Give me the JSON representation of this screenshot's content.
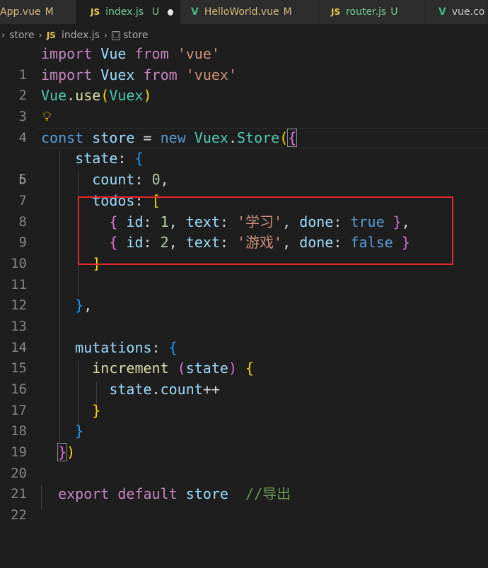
{
  "tabs": [
    {
      "label": "App.vue",
      "status": "M"
    },
    {
      "label": "index.js",
      "status": "U"
    },
    {
      "label": "HelloWorld.vue",
      "status": "M"
    },
    {
      "label": "router.js",
      "status": "U"
    },
    {
      "label": "vue.co"
    }
  ],
  "breadcrumb": {
    "folder": "store",
    "file": "index.js",
    "symbol": "store"
  },
  "line_numbers": [
    "1",
    "2",
    "3",
    "4",
    "5",
    "6",
    "7",
    "8",
    "9",
    "10",
    "11",
    "12",
    "13",
    "14",
    "15",
    "16",
    "17",
    "18",
    "19",
    "20",
    "21",
    "22"
  ],
  "icons": {
    "tab_js": "JS",
    "tab_vue": "vue-logo-icon",
    "lightbulb": "lightbulb-icon",
    "symbol_box": "symbol-object-icon"
  },
  "code": {
    "l1": [
      "import",
      "Vue",
      "from",
      "'vue'"
    ],
    "l2": [
      "import",
      "Vuex",
      "from",
      "'vuex'"
    ],
    "l3": [
      "Vue",
      ".",
      "use",
      "(",
      "Vuex",
      ")"
    ],
    "l5": [
      "const",
      "store",
      "=",
      "new",
      "Vuex",
      ".",
      "Store",
      "(",
      "{"
    ],
    "l6": [
      "state",
      ":",
      "{"
    ],
    "l7": [
      "count",
      ":",
      "0",
      ","
    ],
    "l8": [
      "todos",
      ":",
      "["
    ],
    "l9": [
      "{",
      "id",
      ":",
      "1",
      ",",
      "text",
      ":",
      "'学习'",
      ",",
      "done",
      ":",
      "true",
      "}",
      ","
    ],
    "l10": [
      "{",
      "id",
      ":",
      "2",
      ",",
      "text",
      ":",
      "'游戏'",
      ",",
      "done",
      ":",
      "false",
      "}"
    ],
    "l11": [
      "]"
    ],
    "l13": [
      "}",
      ","
    ],
    "l15": [
      "mutations",
      ":",
      "{"
    ],
    "l16": [
      "increment",
      "(",
      "state",
      ")",
      "{"
    ],
    "l17": [
      "state",
      ".",
      "count",
      "++"
    ],
    "l18": [
      "}"
    ],
    "l19": [
      "}"
    ],
    "l20": [
      "}",
      ")"
    ],
    "l22": [
      "export",
      "default",
      "store",
      "//导出"
    ]
  },
  "colors": {
    "background": "#1e1e1e",
    "highlight_box": "#e0282e"
  }
}
